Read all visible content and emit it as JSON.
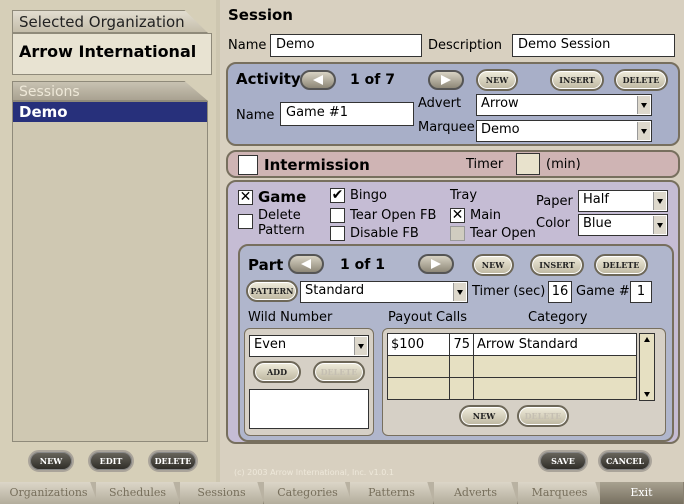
{
  "sidebar": {
    "org_header": "Selected Organization",
    "org_name": "Arrow International",
    "sessions_header": "Sessions",
    "sessions": [
      "Demo"
    ],
    "buttons": {
      "new": "NEW",
      "edit": "EDIT",
      "delete": "DELETE"
    }
  },
  "session": {
    "title": "Session",
    "name_label": "Name",
    "name_value": "Demo",
    "desc_label": "Description",
    "desc_value": "Demo Session"
  },
  "activity": {
    "title": "Activity",
    "counter": "1 of 7",
    "buttons": {
      "new": "NEW",
      "insert": "INSERT",
      "delete": "DELETE"
    },
    "name_label": "Name",
    "name_value": "Game #1",
    "advert_label": "Advert",
    "advert_value": "Arrow",
    "marquee_label": "Marquee",
    "marquee_value": "Demo"
  },
  "intermission": {
    "label": "Intermission",
    "timer_label": "Timer",
    "timer_value": "",
    "unit": "(min)"
  },
  "game": {
    "game_label": "Game",
    "game_checked": "✕",
    "delete_pattern_label": "Delete\nPattern",
    "bingo_label": "Bingo",
    "bingo_checked": "✔",
    "tear_open_fb_label": "Tear Open FB",
    "disable_fb_label": "Disable FB",
    "tray_label": "Tray",
    "main_label": "Main",
    "main_checked": "✕",
    "tear_open_label": "Tear Open",
    "paper_label": "Paper",
    "paper_value": "Half",
    "color_label": "Color",
    "color_value": "Blue"
  },
  "part": {
    "title": "Part",
    "counter": "1 of 1",
    "buttons": {
      "new": "NEW",
      "insert": "INSERT",
      "delete": "DELETE",
      "pattern": "PATTERN"
    },
    "pattern_value": "Standard",
    "timer_label": "Timer (sec)",
    "timer_value": "16",
    "game_num_label": "Game #",
    "game_num_value": "1",
    "wild_label": "Wild Number",
    "wild_value": "Even",
    "wild_buttons": {
      "add": "ADD",
      "delete": "DELETE"
    },
    "columns": {
      "payout": "Payout",
      "calls": "Calls",
      "category": "Category"
    },
    "rows": [
      {
        "payout": "$100",
        "calls": "75",
        "category": "Arrow Standard"
      },
      {
        "payout": "",
        "calls": "",
        "category": ""
      },
      {
        "payout": "",
        "calls": "",
        "category": ""
      }
    ],
    "grid_buttons": {
      "new": "NEW",
      "delete": "DELETE"
    }
  },
  "footer": {
    "copyright": "(c) 2003 Arrow International, Inc. v1.0.1",
    "save": "SAVE",
    "cancel": "CANCEL"
  },
  "tabs": [
    "Organizations",
    "Schedules",
    "Sessions",
    "Categories",
    "Patterns",
    "Adverts",
    "Marquees",
    "Exit"
  ]
}
